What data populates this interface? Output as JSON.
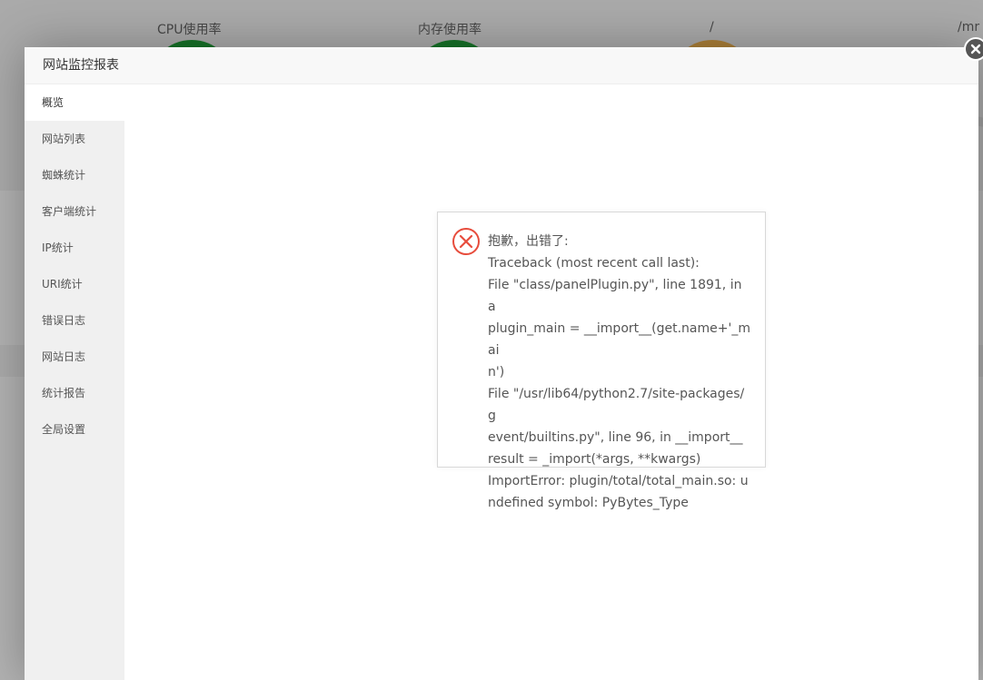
{
  "background": {
    "stats": [
      {
        "label": "CPU使用率",
        "gauge": "green"
      },
      {
        "label": "内存使用率",
        "gauge": "green"
      },
      {
        "label": "/",
        "gauge": "orange"
      },
      {
        "label": "/mr",
        "gauge": "green"
      }
    ]
  },
  "modal": {
    "title": "网站监控报表",
    "close_icon": "close-icon",
    "sidebar": {
      "items": [
        {
          "label": "概览",
          "active": true
        },
        {
          "label": "网站列表",
          "active": false
        },
        {
          "label": "蜘蛛统计",
          "active": false
        },
        {
          "label": "客户端统计",
          "active": false
        },
        {
          "label": "IP统计",
          "active": false
        },
        {
          "label": "URI统计",
          "active": false
        },
        {
          "label": "错误日志",
          "active": false
        },
        {
          "label": "网站日志",
          "active": false
        },
        {
          "label": "统计报告",
          "active": false
        },
        {
          "label": "全局设置",
          "active": false
        }
      ]
    },
    "error": {
      "icon": "error-circle-x-icon",
      "lines": [
        "抱歉，出错了:",
        "Traceback (most recent call last):",
        "File \"class/panelPlugin.py\", line 1891, in a",
        "plugin_main = __import__(get.name+'_mai",
        "n')",
        "File \"/usr/lib64/python2.7/site-packages/g",
        "event/builtins.py\", line 96, in __import__",
        "result = _import(*args, **kwargs)",
        "ImportError: plugin/total/total_main.so: u",
        "ndefined symbol: PyBytes_Type"
      ]
    }
  },
  "colors": {
    "accent_green": "#20a53a",
    "error_red": "#e74c3c",
    "sidebar_bg": "#f0f0f0"
  }
}
